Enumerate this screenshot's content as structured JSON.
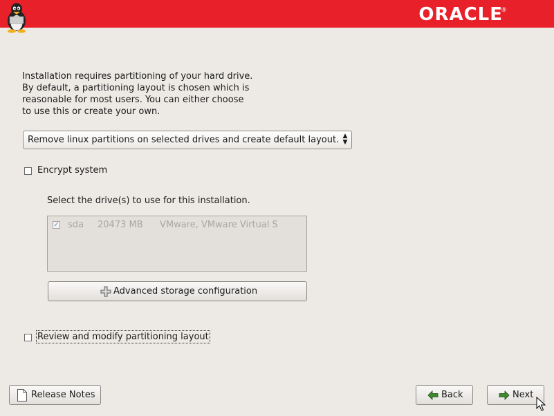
{
  "header": {
    "brand": "ORACLE",
    "brand_mark": "®"
  },
  "intro": {
    "lines": [
      "Installation requires partitioning of your hard drive.",
      "By default, a partitioning layout is chosen which is",
      "reasonable for most users.  You can either choose",
      "to use this or create your own."
    ]
  },
  "layout_select": {
    "selected": "Remove linux partitions on selected drives and create default layout."
  },
  "encrypt": {
    "label": "Encrypt system",
    "checked": false
  },
  "drives": {
    "prompt": "Select the drive(s) to use for this installation.",
    "rows": [
      {
        "checked": true,
        "name": "sda",
        "size": "20473 MB",
        "model": "VMware, VMware Virtual S"
      }
    ]
  },
  "advanced_button": {
    "label": "Advanced storage configuration"
  },
  "review": {
    "label": "Review and modify partitioning layout",
    "checked": false
  },
  "footer": {
    "release_notes": "Release Notes",
    "back": "Back",
    "next": "Next"
  },
  "colors": {
    "header": "#e8202a",
    "background": "#edeae6"
  }
}
